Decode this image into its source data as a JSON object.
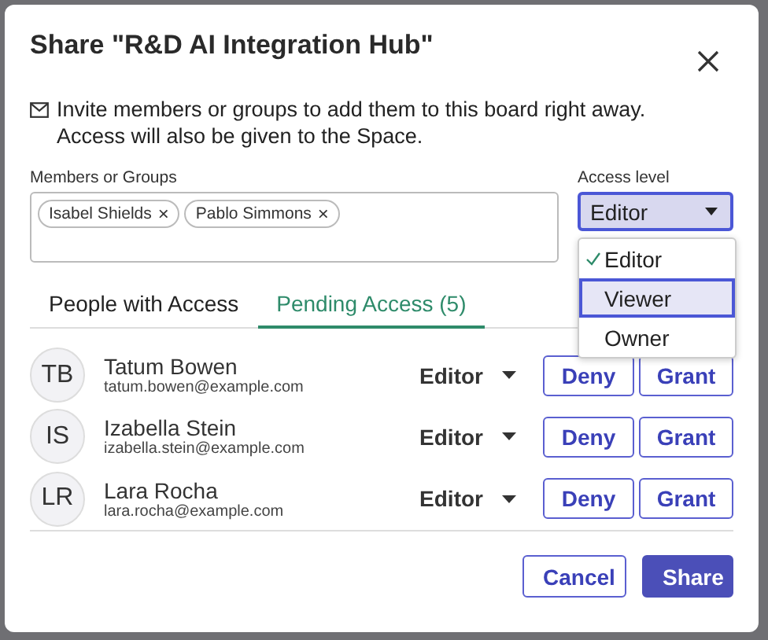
{
  "dialog": {
    "title": "Share \"R&D AI Integration Hub\"",
    "info": "Invite members or groups to add them to this board right away. Access will also be given to the Space."
  },
  "members": {
    "label": "Members or Groups",
    "chips": [
      {
        "name": "Isabel Shields",
        "remove": "×"
      },
      {
        "name": "Pablo Simmons",
        "remove": "×"
      }
    ]
  },
  "access": {
    "label": "Access level",
    "value": "Editor",
    "expanded": true,
    "options": [
      {
        "label": "Editor",
        "checked": true,
        "highlighted": false
      },
      {
        "label": "Viewer",
        "checked": false,
        "highlighted": true
      },
      {
        "label": "Owner",
        "checked": false,
        "highlighted": false
      }
    ]
  },
  "tabs": [
    {
      "label": "People with Access",
      "selected": false
    },
    {
      "label": "Pending Access (5)",
      "selected": true
    }
  ],
  "requests": [
    {
      "initials": "TB",
      "name": "Tatum Bowen",
      "email": "tatum.bowen@example.com",
      "role": "Editor",
      "deny": "Deny",
      "grant": "Grant"
    },
    {
      "initials": "IS",
      "name": "Izabella Stein",
      "email": "izabella.stein@example.com",
      "role": "Editor",
      "deny": "Deny",
      "grant": "Grant"
    },
    {
      "initials": "LR",
      "name": "Lara Rocha",
      "email": "lara.rocha@example.com",
      "role": "Editor",
      "deny": "Deny",
      "grant": "Grant"
    }
  ],
  "buttons": [
    {
      "label": "Cancel",
      "kind": "secondary"
    },
    {
      "label": "Share",
      "kind": "primary"
    }
  ]
}
